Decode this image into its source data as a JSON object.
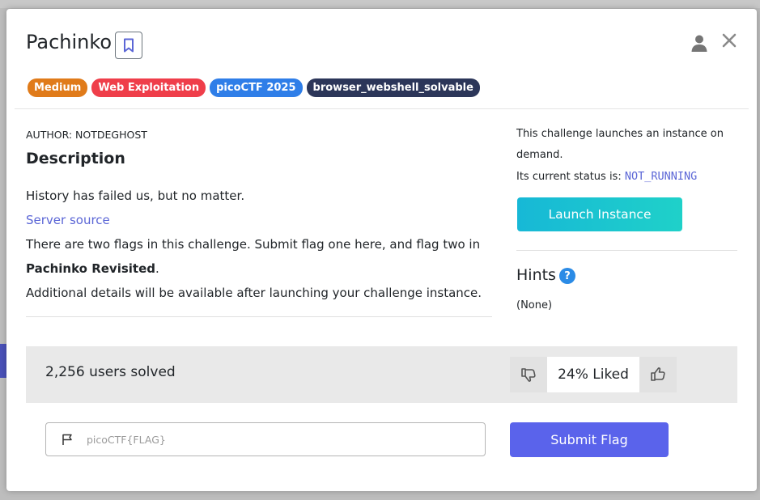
{
  "challenge": {
    "title": "Pachinko",
    "tags": [
      {
        "label": "Medium",
        "color": "#e07b1a"
      },
      {
        "label": "Web Exploitation",
        "color": "#ef3e4a"
      },
      {
        "label": "picoCTF 2025",
        "color": "#2f7ee8"
      },
      {
        "label": "browser_webshell_solvable",
        "color": "#2c3659"
      }
    ],
    "author": "AUTHOR: NOTDEGHOST",
    "description_title": "Description",
    "description": {
      "line1": "History has failed us, but no matter.",
      "link": "Server source",
      "line2_prefix": "There are two flags in this challenge. Submit flag one here, and flag two in",
      "line2_bold": "Pachinko Revisited",
      "line2_suffix": ".",
      "line3": "Additional details will be available after launching your challenge instance."
    }
  },
  "instance": {
    "info_line1": "This challenge launches an instance on",
    "info_line2": "demand.",
    "status_label": "Its current status is:",
    "status_value": "NOT_RUNNING",
    "launch_label": "Launch Instance"
  },
  "hints": {
    "title": "Hints",
    "help_glyph": "?",
    "content": "(None)"
  },
  "stats": {
    "solved": "2,256 users solved",
    "liked": "24% Liked"
  },
  "flag_form": {
    "placeholder": "picoCTF{FLAG}",
    "submit_label": "Submit Flag"
  },
  "icons": [
    "bookmark-icon",
    "user-icon",
    "close-icon",
    "help-icon",
    "thumbs-down-icon",
    "thumbs-up-icon",
    "flag-icon"
  ],
  "colors": {
    "accent": "#5a63eb",
    "launch_gradient": [
      "#17b8d6",
      "#1fd1c9"
    ],
    "link": "#5b66d6"
  }
}
